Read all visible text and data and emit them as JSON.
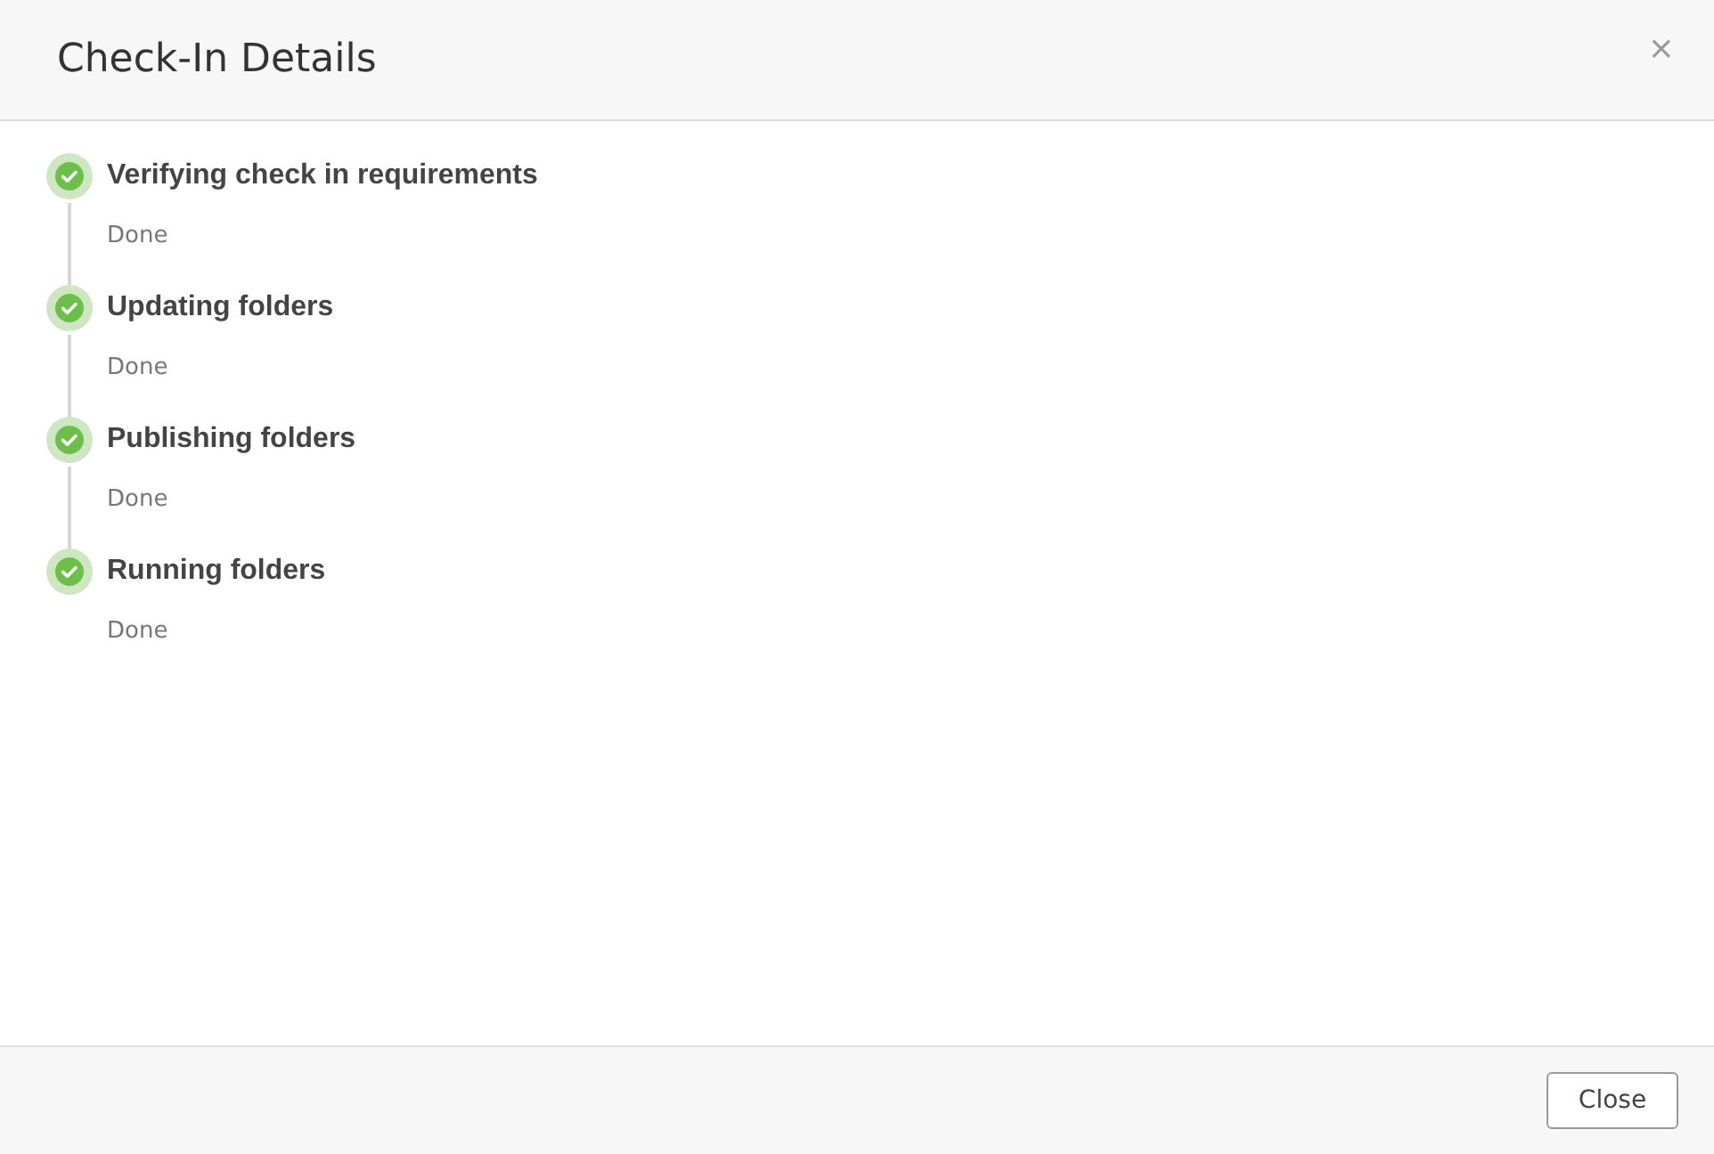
{
  "dialog": {
    "title": "Check-In Details",
    "close_glyph": "×"
  },
  "steps": [
    {
      "title": "Verifying check in requirements",
      "completed": true,
      "detail": "Done"
    },
    {
      "title": "Updating folders",
      "completed": true,
      "detail": "Done"
    },
    {
      "title": "Publishing folders",
      "completed": true,
      "detail": "Done"
    },
    {
      "title": "Running folders",
      "completed": true,
      "detail": "Done"
    }
  ],
  "footer": {
    "buttons": [
      "Close"
    ]
  }
}
